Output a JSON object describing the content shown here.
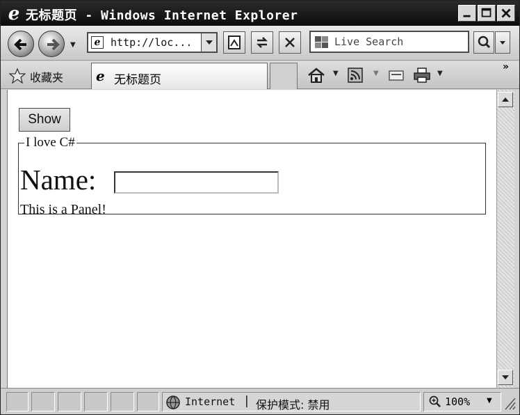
{
  "window": {
    "title_cjk": "无标题页",
    "title_rest": " - Windows Internet Explorer"
  },
  "toolbar": {
    "address_url": "http://loc...",
    "search_placeholder": "Live Search"
  },
  "favorites_bar": {
    "favorites_label": "收藏夹",
    "tab_title": "无标题页",
    "overflow": "»"
  },
  "page": {
    "show_button": "Show",
    "panel_legend": "I love C#",
    "name_label": "Name:",
    "name_value": "",
    "panel_text": "This is a Panel!"
  },
  "statusbar": {
    "zone_name": "Internet",
    "separator": "|",
    "protected_mode": "保护模式: 禁用",
    "zoom": "100%"
  },
  "colors": {
    "title_bg": "#111111",
    "content_bg": "#ffffff",
    "chrome_bg": "#d4d4d4"
  }
}
